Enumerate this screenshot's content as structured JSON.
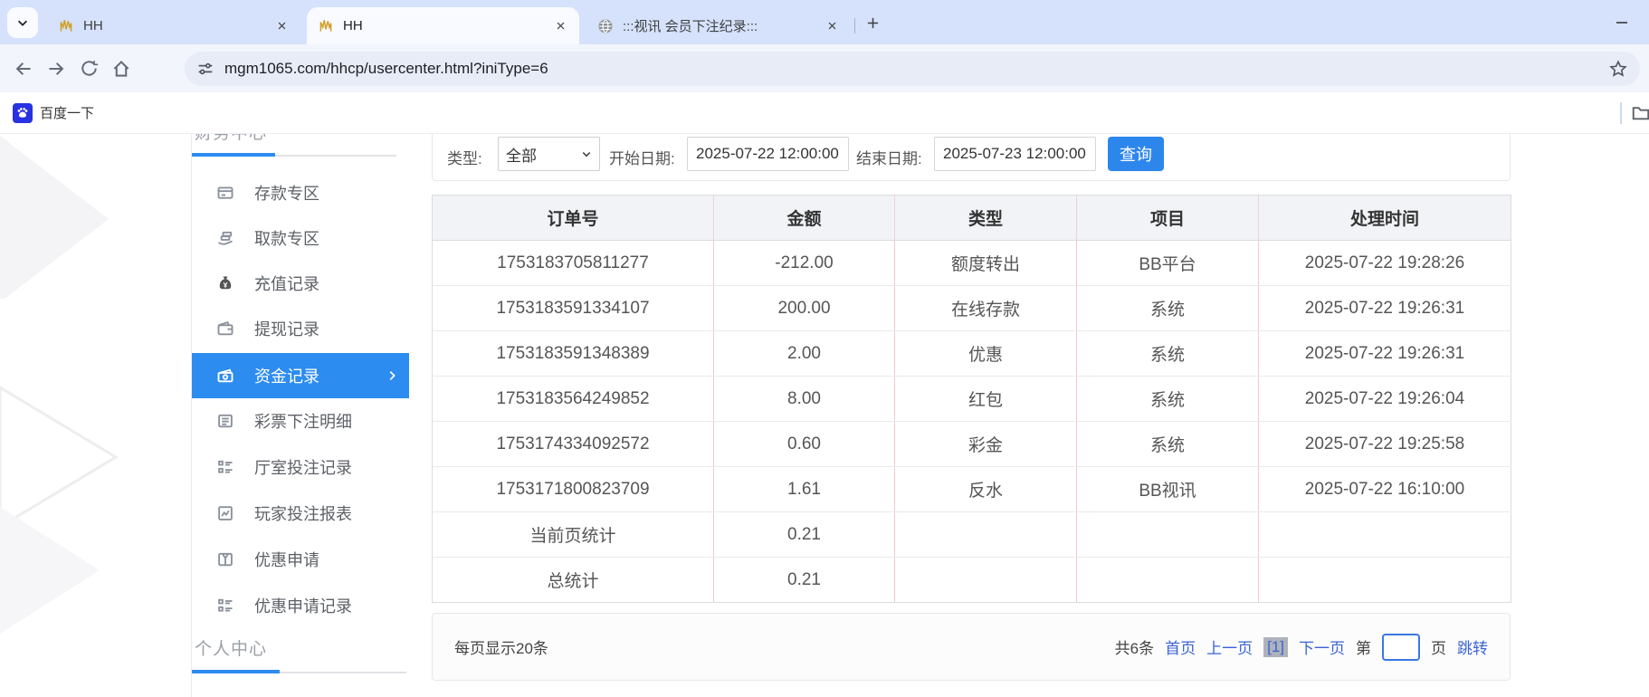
{
  "browser": {
    "tabs": [
      {
        "title": "HH"
      },
      {
        "title": "HH"
      },
      {
        "title": ":::视讯 会员下注纪录:::"
      }
    ],
    "url": "mgm1065.com/hhcp/usercenter.html?iniType=6",
    "bookmark_label": "百度一下"
  },
  "colors": {
    "accent": "#2d8cf0",
    "link": "#3a63d2",
    "logo_gold": "#d2a528",
    "baidu_blue": "#2932e1"
  },
  "sidebar": {
    "top_section": "财务中心",
    "bottom_section": "个人中心",
    "items": [
      {
        "label": "存款专区",
        "icon": "bank-card-icon"
      },
      {
        "label": "取款专区",
        "icon": "hand-money-icon"
      },
      {
        "label": "充值记录",
        "icon": "money-bag-icon"
      },
      {
        "label": "提现记录",
        "icon": "wallet-icon"
      },
      {
        "label": "资金记录",
        "icon": "cash-icon",
        "active": true
      },
      {
        "label": "彩票下注明细",
        "icon": "document-list-icon"
      },
      {
        "label": "厅室投注记录",
        "icon": "checklist-icon"
      },
      {
        "label": "玩家投注报表",
        "icon": "chart-icon"
      },
      {
        "label": "优惠申请",
        "icon": "gift-icon"
      },
      {
        "label": "优惠申请记录",
        "icon": "checklist-icon"
      }
    ]
  },
  "filters": {
    "type_label": "类型:",
    "type_value": "全部",
    "start_label": "开始日期:",
    "start_value": "2025-07-22 12:00:00",
    "end_label": "结束日期:",
    "end_value": "2025-07-23 12:00:00",
    "search_button": "查询"
  },
  "table": {
    "headers": [
      "订单号",
      "金额",
      "类型",
      "项目",
      "处理时间"
    ],
    "rows": [
      [
        "1753183705811277",
        "-212.00",
        "额度转出",
        "BB平台",
        "2025-07-22 19:28:26"
      ],
      [
        "1753183591334107",
        "200.00",
        "在线存款",
        "系统",
        "2025-07-22 19:26:31"
      ],
      [
        "1753183591348389",
        "2.00",
        "优惠",
        "系统",
        "2025-07-22 19:26:31"
      ],
      [
        "1753183564249852",
        "8.00",
        "红包",
        "系统",
        "2025-07-22 19:26:04"
      ],
      [
        "1753174334092572",
        "0.60",
        "彩金",
        "系统",
        "2025-07-22 19:25:58"
      ],
      [
        "1753171800823709",
        "1.61",
        "反水",
        "BB视讯",
        "2025-07-22 16:10:00"
      ],
      [
        "当前页统计",
        "0.21",
        "",
        "",
        ""
      ],
      [
        "总统计",
        "0.21",
        "",
        "",
        ""
      ]
    ]
  },
  "pagination": {
    "page_size_text": "每页显示20条",
    "total_text": "共6条",
    "first": "首页",
    "prev": "上一页",
    "current": "[1]",
    "next": "下一页",
    "jump_prefix": "第",
    "jump_suffix": "页",
    "jump_button": "跳转",
    "jump_value": ""
  }
}
